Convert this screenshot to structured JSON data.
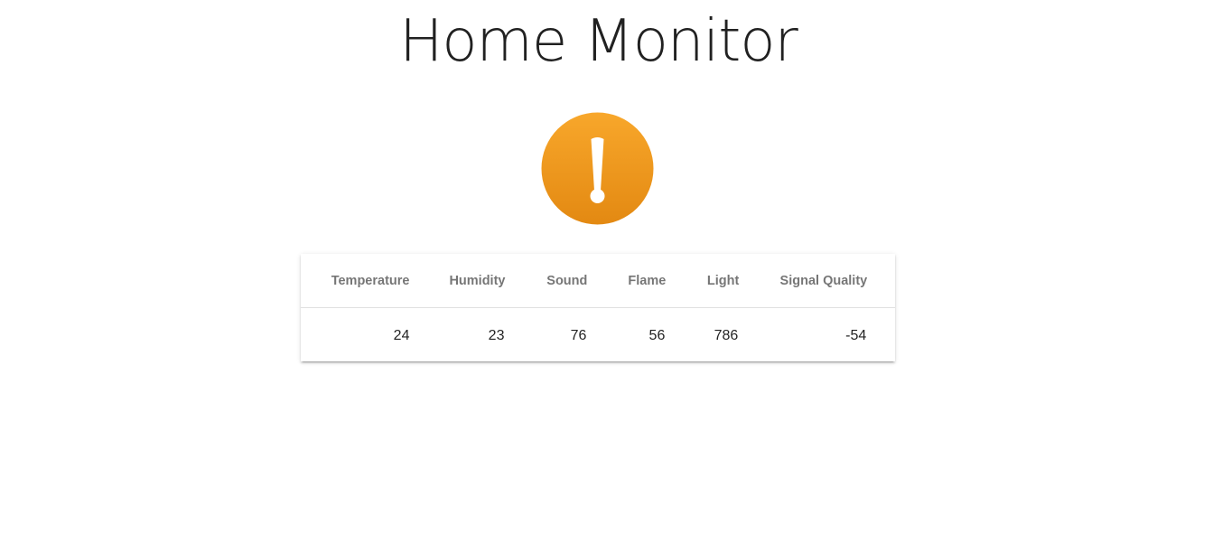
{
  "header": {
    "title": "Home Monitor"
  },
  "status": {
    "icon": "exclamation-alert-icon",
    "color_top": "#f8a72b",
    "color_bottom": "#e38912"
  },
  "sensor_table": {
    "columns": [
      "Temperature",
      "Humidity",
      "Sound",
      "Flame",
      "Light",
      "Signal Quality"
    ],
    "rows": [
      [
        "24",
        "23",
        "76",
        "56",
        "786",
        "-54"
      ]
    ]
  }
}
